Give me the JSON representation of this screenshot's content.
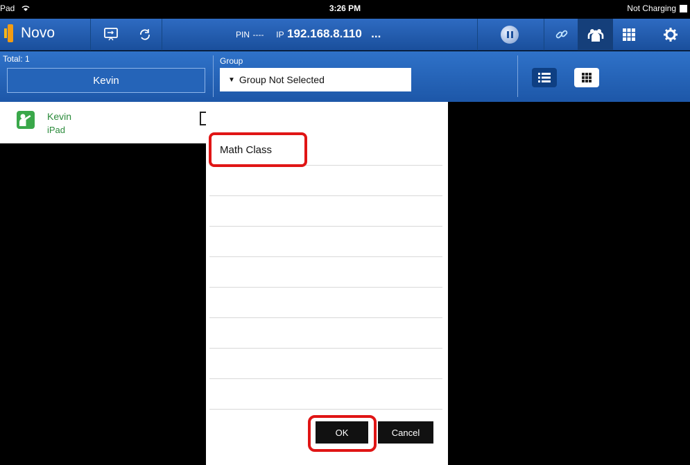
{
  "status": {
    "device": "Pad",
    "time": "3:26 PM",
    "charging": "Not Charging"
  },
  "toolbar": {
    "app_name": "Novo",
    "pin_label": "PIN",
    "pin_value": "----",
    "ip_label": "IP",
    "ip_value": "192.168.8.110",
    "more": "..."
  },
  "panel": {
    "total": "Total: 1",
    "selected_user": "Kevin",
    "group_label": "Group",
    "group_select": "Group Not Selected"
  },
  "users": [
    {
      "name": "Kevin",
      "device": "iPad"
    }
  ],
  "popup": {
    "items": [
      "Math Class"
    ],
    "ok_label": "OK",
    "cancel_label": "Cancel"
  },
  "colors": {
    "toolbar": "#1a4f9c",
    "highlight": "#e01515",
    "user_green": "#3aa84a"
  }
}
